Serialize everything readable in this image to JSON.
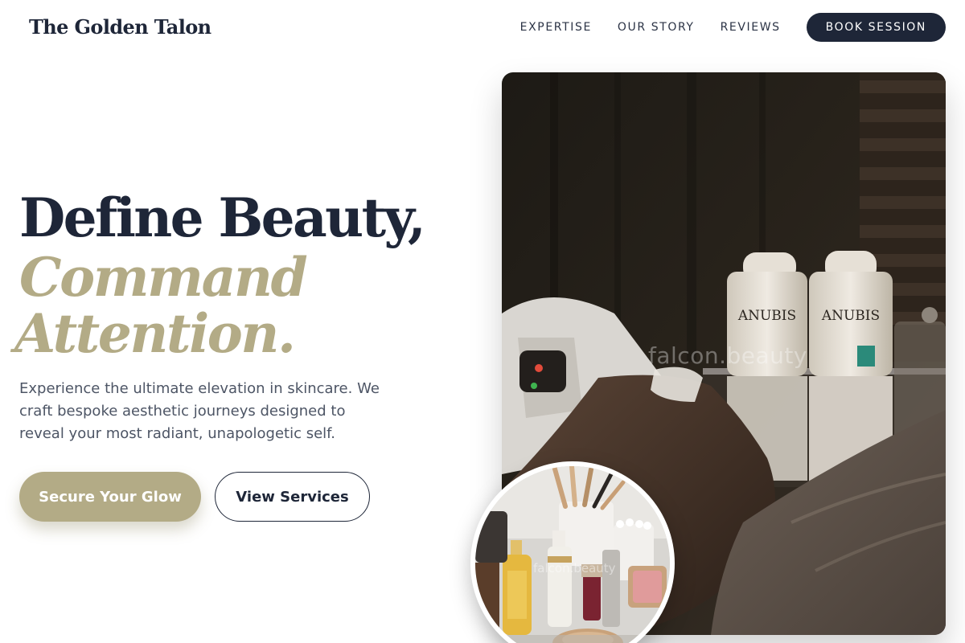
{
  "brand": {
    "name": "The Golden Talon"
  },
  "nav": {
    "links": [
      "EXPERTISE",
      "OUR STORY",
      "REVIEWS"
    ],
    "cta_label": "BOOK SESSION"
  },
  "hero": {
    "headline_line1": "Define Beauty,",
    "headline_line2": "Command",
    "headline_line3": "Attention.",
    "description": "Experience the ultimate elevation in skincare. We craft bespoke aesthetic journeys designed to reveal your most radiant, unapologetic self.",
    "primary_button": "Secure Your Glow",
    "secondary_button": "View Services"
  },
  "images": {
    "main_product_label_1": "ANUBIS",
    "main_product_label_2": "ANUBIS",
    "main_watermark": "falcon.beauty",
    "circle_watermark": "falcon.beauty"
  },
  "colors": {
    "navy": "#1e2638",
    "gold": "#b3ab86",
    "body_text": "#4d5565"
  }
}
